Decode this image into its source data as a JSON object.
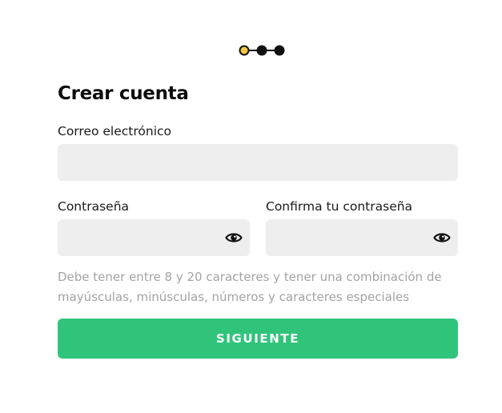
{
  "stepper": {
    "total_steps": 3,
    "current_step": 1,
    "colors": {
      "active_fill": "#f5c842",
      "dot": "#111111",
      "connector": "#111111"
    }
  },
  "form": {
    "title": "Crear cuenta",
    "email": {
      "label": "Correo electrónico",
      "value": "",
      "placeholder": ""
    },
    "password": {
      "label": "Contraseña",
      "value": "",
      "placeholder": "",
      "toggle_icon": "eye-icon"
    },
    "confirm_password": {
      "label": "Confirma tu contraseña",
      "value": "",
      "placeholder": "",
      "toggle_icon": "eye-icon"
    },
    "hint": "Debe tener entre 8 y 20 caracteres y tener una combinación de mayúsculas, minúsculas, números y caracteres especiales",
    "submit_label": "SIGUIENTE"
  },
  "colors": {
    "primary": "#30c47b",
    "field_background": "#eeeeee",
    "hint_text": "#a3a3a3",
    "text": "#111111"
  }
}
